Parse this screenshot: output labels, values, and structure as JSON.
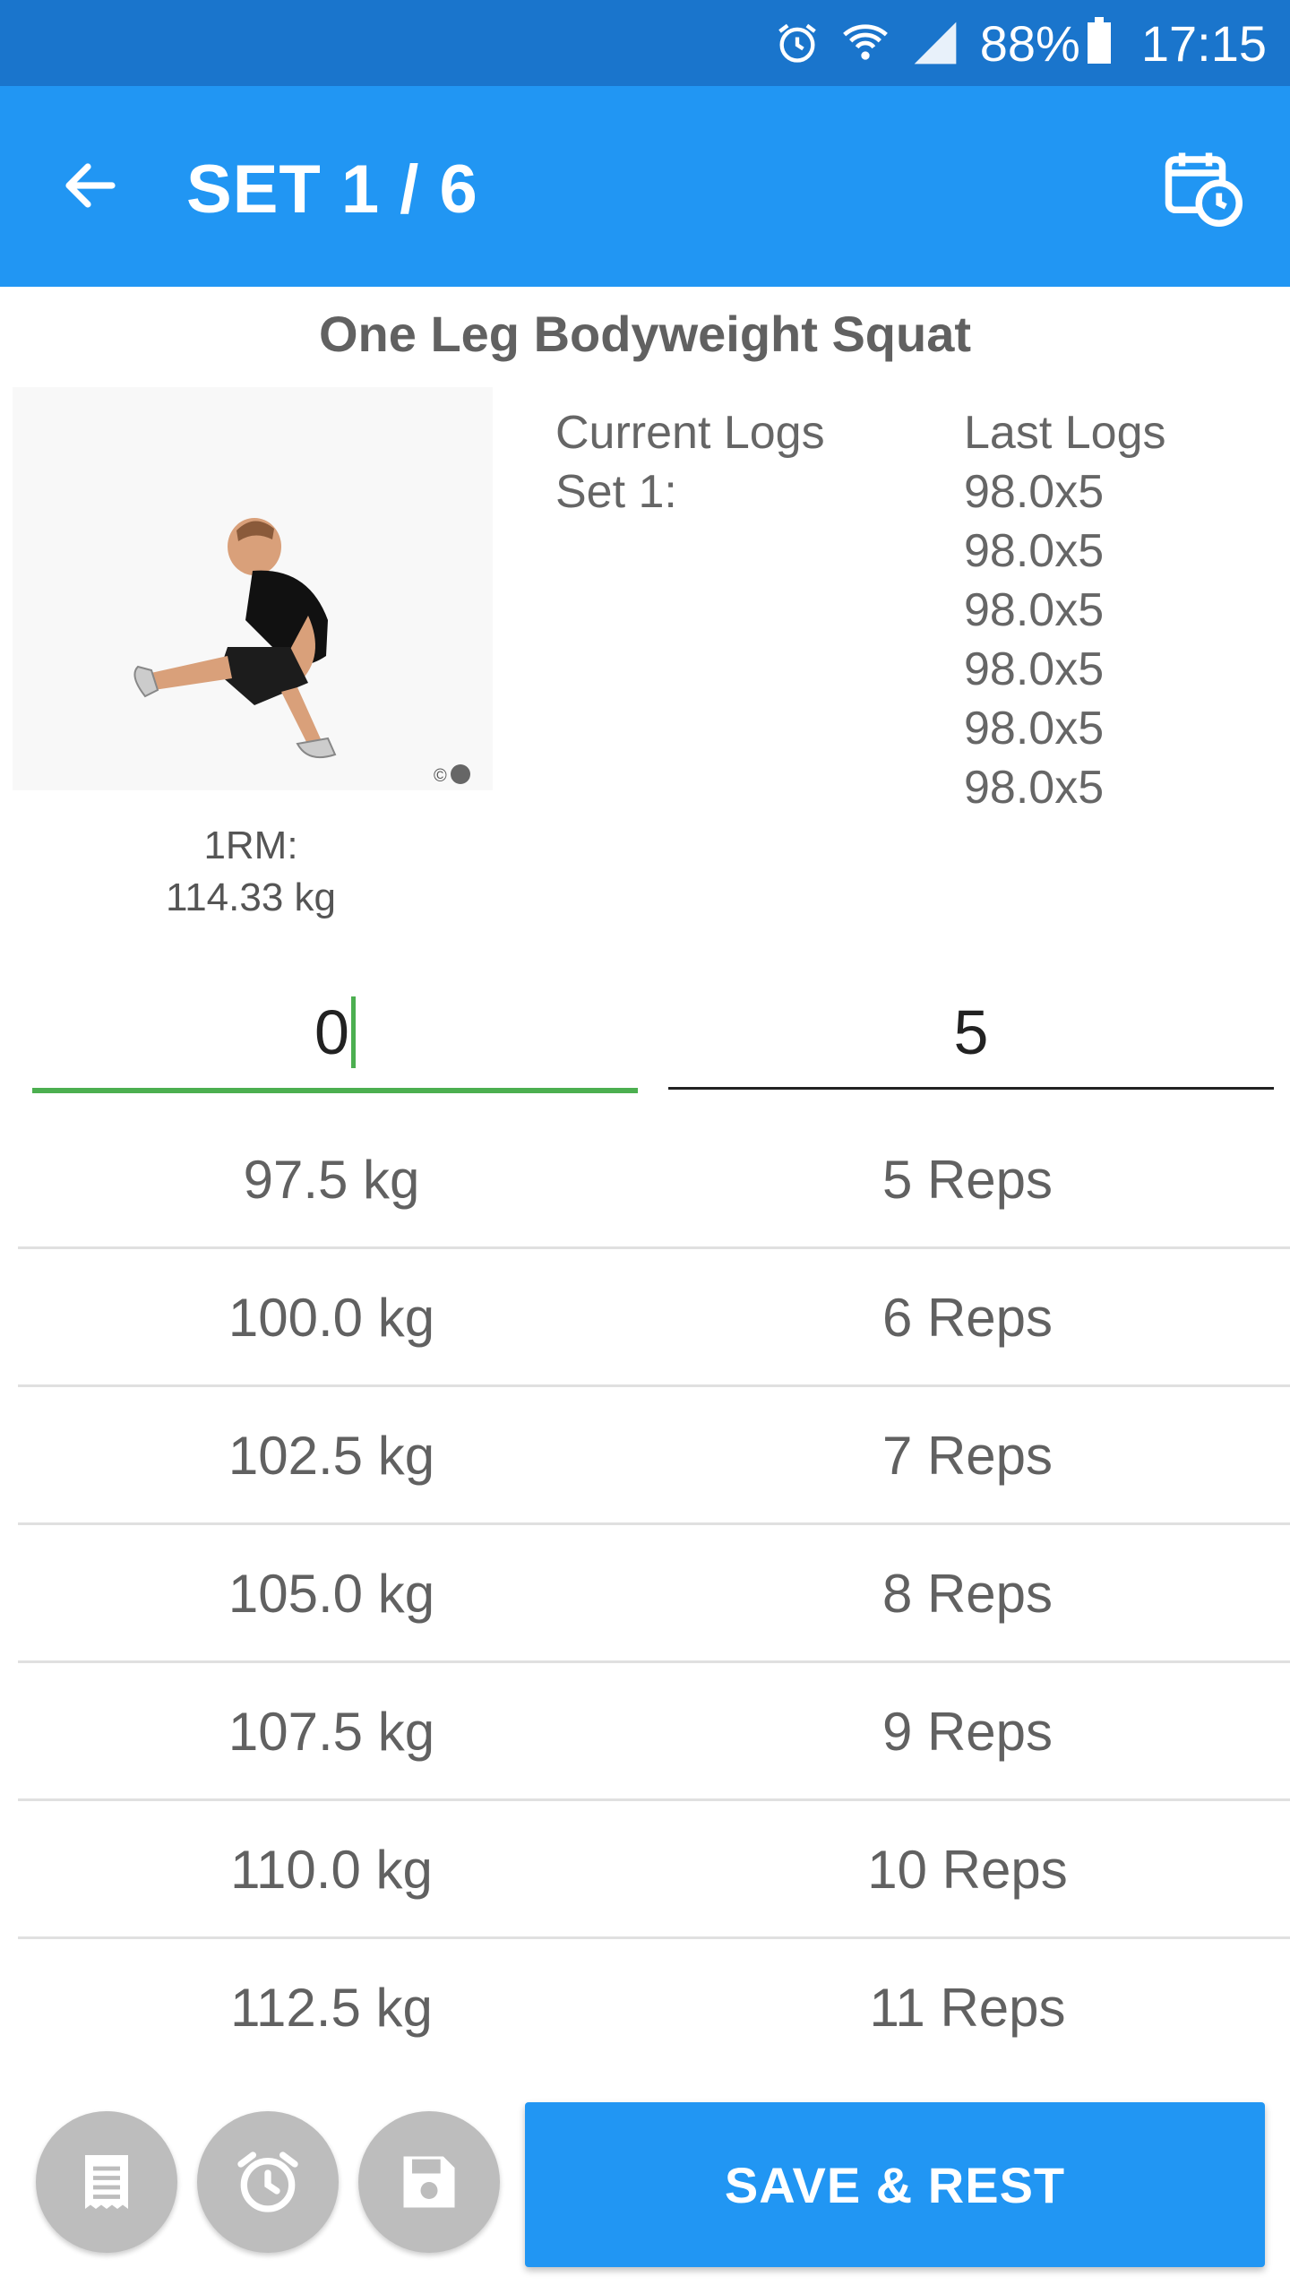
{
  "status_bar": {
    "battery": "88%",
    "time": "17:15",
    "icons": [
      "alarm-icon",
      "wifi-icon",
      "signal-icon",
      "battery-icon"
    ]
  },
  "app_bar": {
    "title": "SET 1 / 6",
    "back_icon": "arrow-back-icon",
    "action_icon": "calendar-clock-icon",
    "color": "#2196f3"
  },
  "exercise": {
    "name": "One Leg Bodyweight Squat",
    "one_rm_label": "1RM:",
    "one_rm_value": "114.33 kg"
  },
  "logs": {
    "current_header": "Current Logs",
    "current_entries": [
      "Set 1:"
    ],
    "last_header": "Last Logs",
    "last_entries": [
      "98.0x5",
      "98.0x5",
      "98.0x5",
      "98.0x5",
      "98.0x5",
      "98.0x5"
    ]
  },
  "inputs": {
    "weight_value": "0",
    "reps_value": "5",
    "focus_color": "#4caf50"
  },
  "picker": {
    "rows": [
      {
        "weight": "97.5 kg",
        "reps": "5 Reps"
      },
      {
        "weight": "100.0 kg",
        "reps": "6 Reps"
      },
      {
        "weight": "102.5 kg",
        "reps": "7 Reps"
      },
      {
        "weight": "105.0 kg",
        "reps": "8 Reps"
      },
      {
        "weight": "107.5 kg",
        "reps": "9 Reps"
      },
      {
        "weight": "110.0 kg",
        "reps": "10 Reps"
      },
      {
        "weight": "112.5 kg",
        "reps": "11 Reps"
      }
    ]
  },
  "actions": {
    "notes_icon": "notes-icon",
    "alarm_icon": "alarm-clock-icon",
    "save_icon": "floppy-disk-icon",
    "primary_label": "SAVE & REST"
  }
}
